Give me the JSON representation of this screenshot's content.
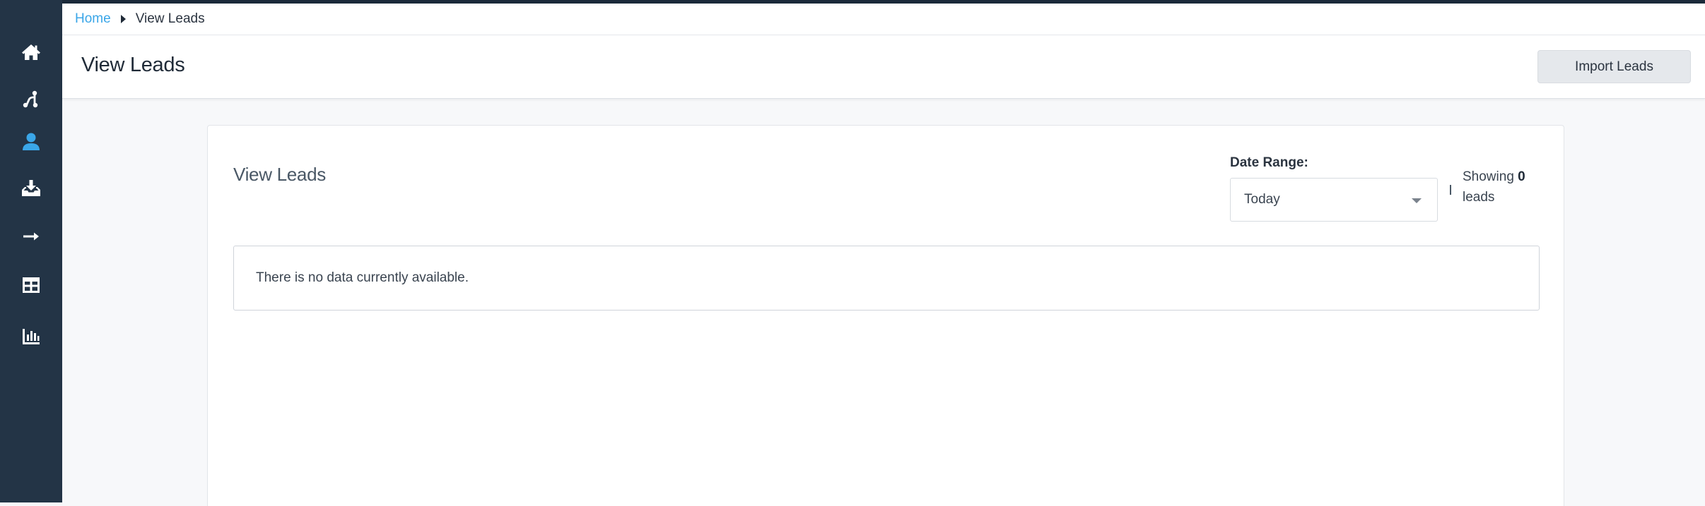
{
  "sidebar": {
    "items": [
      {
        "icon": "home-icon"
      },
      {
        "icon": "workflow-icon"
      },
      {
        "icon": "user-icon",
        "active": true
      },
      {
        "icon": "inbox-download-icon"
      },
      {
        "icon": "arrow-right-icon"
      },
      {
        "icon": "table-icon"
      },
      {
        "icon": "bar-chart-icon"
      }
    ],
    "active_color": "#3aa6e8"
  },
  "breadcrumb": {
    "home": "Home",
    "current": "View Leads"
  },
  "header": {
    "title": "View Leads",
    "import_button": "Import Leads"
  },
  "card": {
    "title": "View Leads",
    "date_range_label": "Date Range:",
    "date_range_value": "Today",
    "showing_prefix": "Showing",
    "showing_count": "0",
    "showing_suffix": "leads",
    "empty_message": "There is no data currently available."
  }
}
